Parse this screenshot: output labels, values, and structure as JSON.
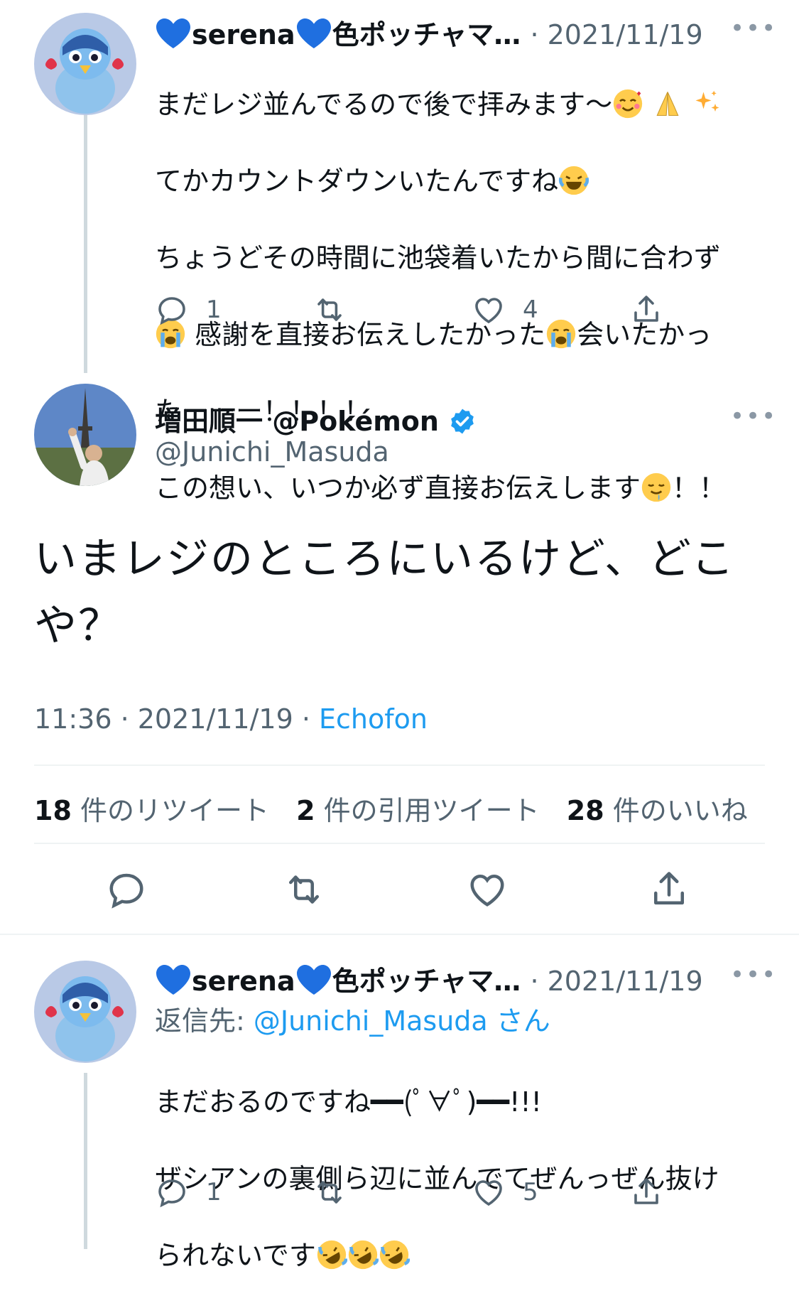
{
  "tweet1": {
    "name_a": "serena",
    "name_b": "色ポッチャマ…",
    "date": "· 2021/11/19",
    "more": "•••",
    "lines": [
      "まだレジ並んでるので後で拝みます〜",
      "てかカウントダウンいたんですね",
      "ちょうどその時間に池袋着いたから間に合わず",
      " 感謝を直接お伝えしたかった",
      "会いたかっ",
      "たーーー！！！！",
      "この想い、いつか必ず直接お伝えします",
      "！！"
    ],
    "replies": "1",
    "likes": "4"
  },
  "main": {
    "display_name": "増田順一 @Pokémon",
    "handle": "@Junichi_Masuda",
    "more": "•••",
    "text_line1": "いまレジのところにいるけど、どこ",
    "text_line2": "や？",
    "time": "11:36 · 2021/11/19 · ",
    "source": "Echofon",
    "retweets_count": "18",
    "retweets_label": "件のリツイート",
    "quotes_count": "2",
    "quotes_label": "件の引用ツイート",
    "likes_count": "28",
    "likes_label": "件のいいね"
  },
  "tweet2": {
    "name_a": "serena",
    "name_b": "色ポッチャマ…",
    "date": "· 2021/11/19",
    "more": "•••",
    "reply_prefix": "返信先: ",
    "reply_handle": "@Junichi_Masuda",
    "reply_suffix": " さん",
    "lines": [
      "まだおるのですね━━(ﾟ∀ﾟ)━━!!!",
      "ザシアンの裏側ら辺に並んでてぜんっぜん抜け",
      "られないです"
    ],
    "replies": "1",
    "likes": "5"
  },
  "colors": {
    "accent": "#1d9bf0",
    "muted": "#536471",
    "line": "#cfd9de"
  }
}
